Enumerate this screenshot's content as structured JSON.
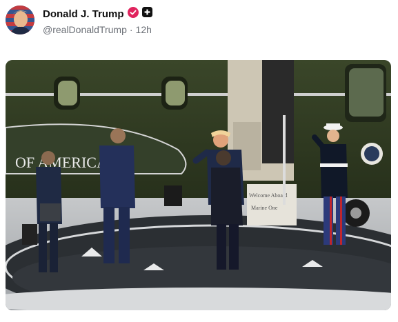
{
  "post": {
    "author": {
      "display_name": "Donald J. Trump",
      "handle": "@realDonaldTrump",
      "verified_badge_color": "#e0245e",
      "extra_badge_icon": "plus-square-icon"
    },
    "separator": "·",
    "timestamp": "12h",
    "image": {
      "helicopter_text": "OF AMERICA",
      "stair_text_top": "Welcome Aboard",
      "stair_text_bottom": "Marine One",
      "helicopter_color": "#2f3a22",
      "ground_color": "#2b2f33"
    }
  }
}
